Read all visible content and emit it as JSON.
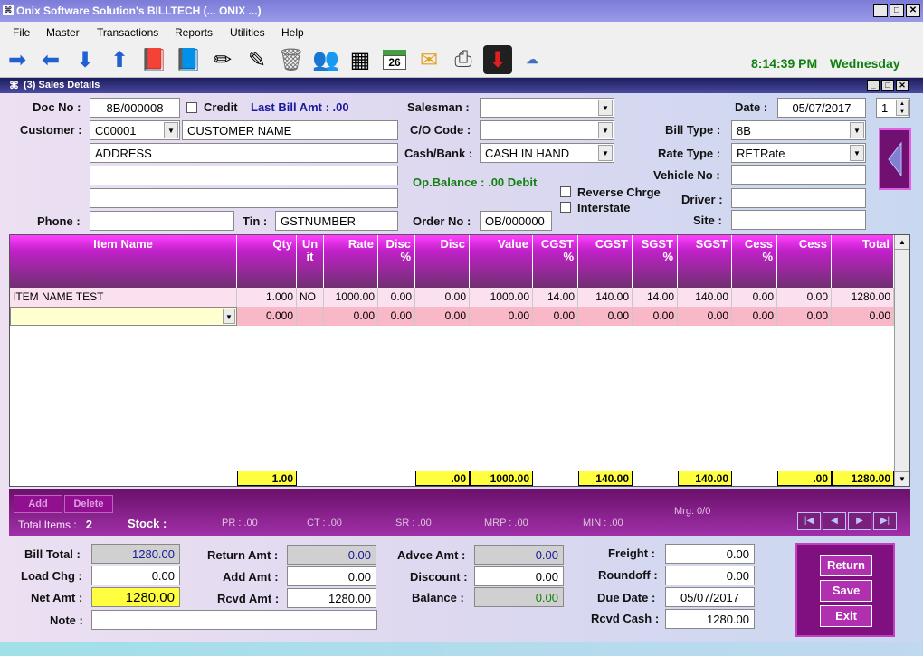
{
  "window": {
    "title": "Onix Software Solution's BILLTECH (... ONIX ...)",
    "child_title": "(3) Sales Details"
  },
  "menu": [
    "File",
    "Master",
    "Transactions",
    "Reports",
    "Utilities",
    "Help"
  ],
  "toolbar": {
    "time": "8:14:39 PM",
    "day": "Wednesday",
    "calendar_day": "26"
  },
  "header": {
    "doc_no_label": "Doc No",
    "doc_no": "8B/000008",
    "credit_label": "Credit",
    "last_bill_label": "Last Bill Amt",
    "last_bill_value": ".00",
    "salesman_label": "Salesman",
    "salesman": "",
    "date_label": "Date",
    "date": "05/07/2017",
    "page_value": "1",
    "customer_label": "Customer",
    "customer_code": "C00001",
    "customer_name": "CUSTOMER NAME",
    "co_code_label": "C/O Code",
    "co_code": "",
    "bill_type_label": "Bill Type",
    "bill_type": "8B",
    "address": "ADDRESS",
    "address2": "",
    "address3": "",
    "cash_bank_label": "Cash/Bank",
    "cash_bank": "CASH IN HAND",
    "rate_type_label": "Rate Type",
    "rate_type": "RETRate",
    "op_balance_label": "Op.Balance",
    "op_balance_value": ".00",
    "op_balance_type": "Debit",
    "vehicle_no_label": "Vehicle No",
    "vehicle_no": "",
    "reverse_charge_label": "Reverse Chrge",
    "interstate_label": "Interstate",
    "driver_label": "Driver",
    "driver": "",
    "phone_label": "Phone",
    "phone": "",
    "tin_label": "Tin",
    "tin": "GSTNUMBER",
    "order_no_label": "Order No",
    "order_no": "OB/000000",
    "site_label": "Site",
    "site": ""
  },
  "grid": {
    "columns": [
      "Item Name",
      "Qty",
      "Un it",
      "Rate",
      "Disc %",
      "Disc",
      "Value",
      "CGST %",
      "CGST",
      "SGST %",
      "SGST",
      "Cess %",
      "Cess",
      "Total"
    ],
    "rows": [
      [
        "ITEM NAME TEST",
        "1.000",
        "NO",
        "1000.00",
        "0.00",
        "0.00",
        "1000.00",
        "14.00",
        "140.00",
        "14.00",
        "140.00",
        "0.00",
        "0.00",
        "1280.00"
      ],
      [
        "",
        "0.000",
        "",
        "0.00",
        "0.00",
        "0.00",
        "0.00",
        "0.00",
        "0.00",
        "0.00",
        "0.00",
        "0.00",
        "0.00",
        "0.00"
      ]
    ],
    "totals": {
      "qty": "1.00",
      "disc": ".00",
      "value": "1000.00",
      "cgst": "140.00",
      "sgst": "140.00",
      "cess": ".00",
      "total": "1280.00"
    }
  },
  "status": {
    "add_label": "Add",
    "delete_label": "Delete",
    "total_items_label": "Total Items",
    "total_items": "2",
    "stock_label": "Stock :",
    "pr": "PR : .00",
    "ct": "CT : .00",
    "sr": "SR : .00",
    "mrp": "MRP : .00",
    "min": "MIN : .00",
    "mrg": "Mrg: 0/0"
  },
  "footer": {
    "bill_total_label": "Bill Total",
    "bill_total": "1280.00",
    "return_amt_label": "Return Amt",
    "return_amt": "0.00",
    "advce_amt_label": "Advce Amt",
    "advce_amt": "0.00",
    "freight_label": "Freight",
    "freight": "0.00",
    "load_chg_label": "Load Chg",
    "load_chg": "0.00",
    "add_amt_label": "Add Amt",
    "add_amt": "0.00",
    "discount_label": "Discount",
    "discount": "0.00",
    "roundoff_label": "Roundoff",
    "roundoff": "0.00",
    "net_amt_label": "Net Amt",
    "net_amt": "1280.00",
    "rcvd_amt_label": "Rcvd Amt",
    "rcvd_amt": "1280.00",
    "balance_label": "Balance",
    "balance": "0.00",
    "due_date_label": "Due Date",
    "due_date": "05/07/2017",
    "note_label": "Note",
    "note": "",
    "rcvd_cash_label": "Rcvd Cash",
    "rcvd_cash": "1280.00"
  },
  "actions": {
    "return_label": "Return",
    "save_label": "Save",
    "exit_label": "Exit"
  }
}
